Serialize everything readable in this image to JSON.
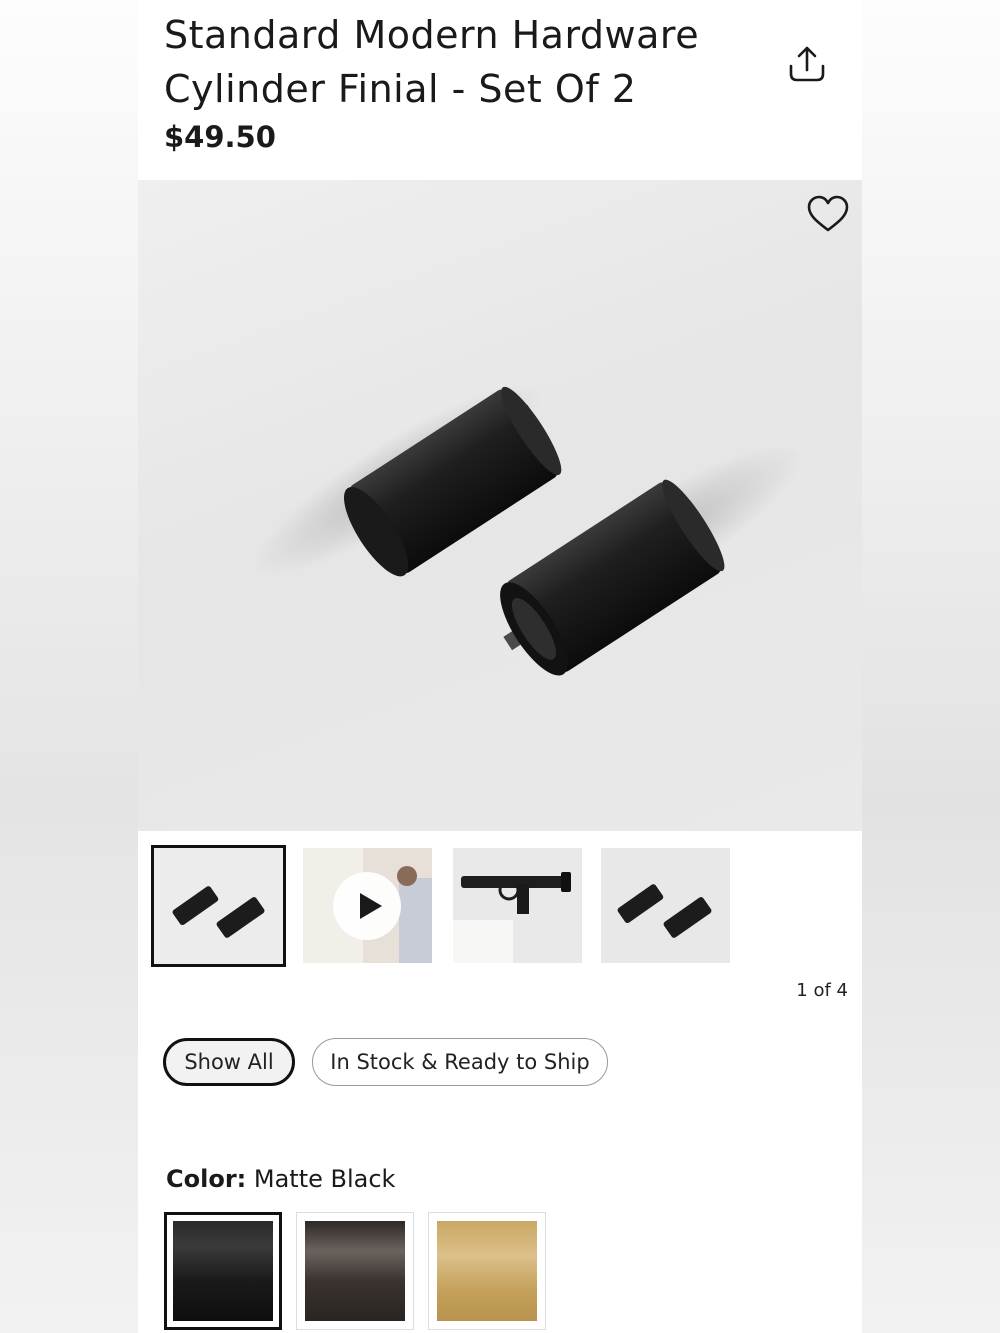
{
  "product": {
    "title": "Standard Modern Hardware Cylinder Finial - Set Of 2",
    "price": "$49.50"
  },
  "icons": {
    "share": "share-upload-icon",
    "favorite": "heart-outline-icon",
    "play": "play-icon"
  },
  "gallery": {
    "thumbnails": [
      {
        "label": "two black cylinder finials",
        "selected": true
      },
      {
        "label": "video of person hanging curtain",
        "video": true
      },
      {
        "label": "finial on curtain rod with ring"
      },
      {
        "label": "two black cylinder finials"
      }
    ],
    "counter": "1 of 4"
  },
  "filters": {
    "show_all": "Show All",
    "in_stock": "In Stock & Ready to Ship"
  },
  "color": {
    "label": "Color:",
    "value": "Matte Black",
    "swatches": [
      {
        "name": "Matte Black",
        "color": "#1c1c1c",
        "selected": true
      },
      {
        "name": "Bronze",
        "color": "#3a3330"
      },
      {
        "name": "Brass",
        "color": "#c9a865"
      }
    ]
  }
}
